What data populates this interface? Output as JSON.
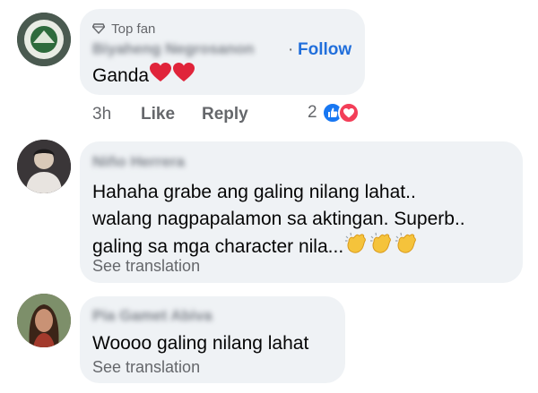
{
  "comments": [
    {
      "badge": "Top fan",
      "author": "Biyaheng Negrosanon",
      "follow_label": "Follow",
      "follow_sep": "·",
      "text": "Ganda",
      "time": "3h",
      "like_label": "Like",
      "reply_label": "Reply",
      "reaction_count": "2",
      "reactions": [
        "like-icon",
        "love-icon"
      ],
      "emojis": [
        "heart-icon",
        "heart-icon"
      ]
    },
    {
      "author": "Niño Herrera",
      "lines": [
        "Hahaha grabe ang galing nilang lahat..",
        "walang nagpapalamon sa aktingan. Superb..",
        "galing sa mga character nila..."
      ],
      "emojis": [
        "clapping-hands-icon",
        "clapping-hands-icon",
        "clapping-hands-icon"
      ],
      "translation_label": "See translation"
    },
    {
      "author": "Pia Gamet Abiva",
      "text": "Woooo galing nilang lahat",
      "translation_label": "See translation"
    }
  ],
  "colors": {
    "bubble": "#eff2f5",
    "link": "#216fdb",
    "muted": "#65676b",
    "heart": "#e0243a",
    "like_blue": "#1877f2"
  }
}
